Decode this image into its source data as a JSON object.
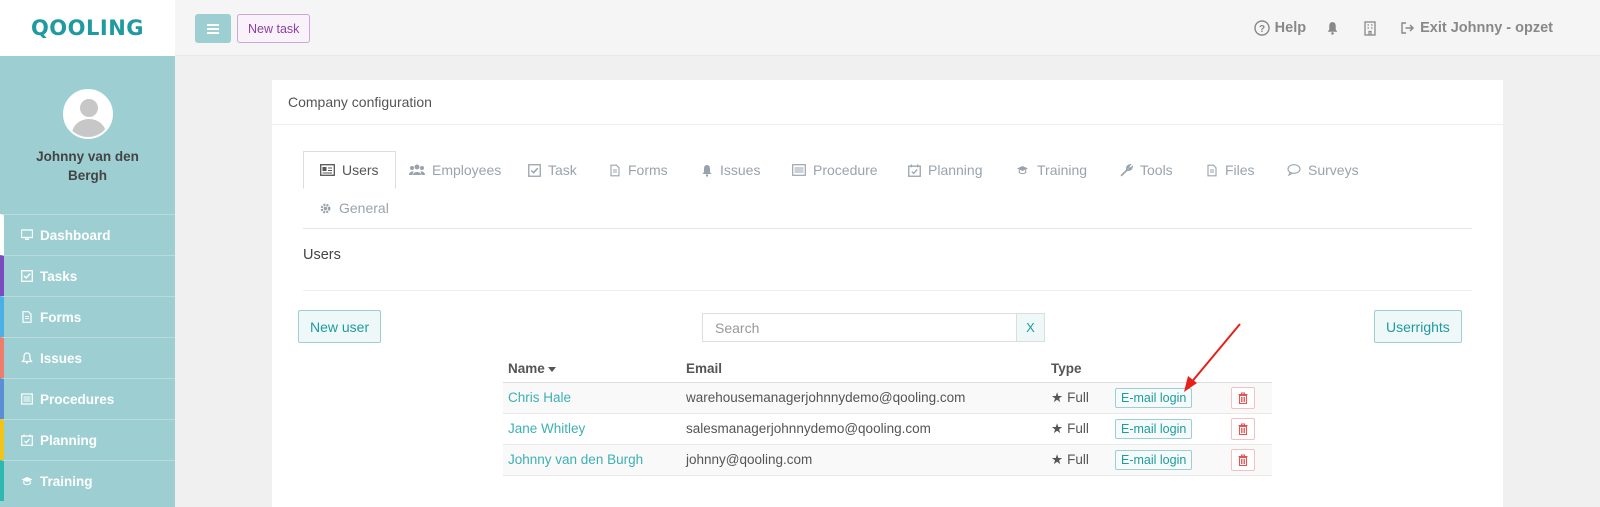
{
  "app": {
    "logo": "Qooling"
  },
  "user": {
    "name": "Johnny van den Bergh"
  },
  "sidebar": {
    "items": [
      {
        "label": "Dashboard",
        "icon": "monitor-icon",
        "accent": "#ffffff"
      },
      {
        "label": "Tasks",
        "icon": "check-square-icon",
        "accent": "#7b4bbf"
      },
      {
        "label": "Forms",
        "icon": "file-icon",
        "accent": "#4ab0e8"
      },
      {
        "label": "Issues",
        "icon": "bell-icon",
        "accent": "#f07c6c"
      },
      {
        "label": "Procedures",
        "icon": "list-icon",
        "accent": "#5a8fd6"
      },
      {
        "label": "Planning",
        "icon": "calendar-check-icon",
        "accent": "#f0c419"
      },
      {
        "label": "Training",
        "icon": "graduation-cap-icon",
        "accent": "#2fb8b0"
      }
    ]
  },
  "topbar": {
    "new_task": "New task",
    "help": "Help",
    "exit": "Exit Johnny - opzet"
  },
  "panel": {
    "title": "Company configuration",
    "tabs": [
      {
        "label": "Users",
        "icon": "id-card-icon",
        "active": true
      },
      {
        "label": "Employees",
        "icon": "users-icon"
      },
      {
        "label": "Task",
        "icon": "check-square-icon"
      },
      {
        "label": "Forms",
        "icon": "file-icon"
      },
      {
        "label": "Issues",
        "icon": "bell-icon"
      },
      {
        "label": "Procedure",
        "icon": "list-icon"
      },
      {
        "label": "Planning",
        "icon": "calendar-check-icon"
      },
      {
        "label": "Training",
        "icon": "graduation-cap-icon"
      },
      {
        "label": "Tools",
        "icon": "wrench-icon"
      },
      {
        "label": "Files",
        "icon": "file-icon"
      },
      {
        "label": "Surveys",
        "icon": "chat-bubble-icon"
      },
      {
        "label": "General",
        "icon": "gear-icon"
      }
    ],
    "section_title": "Users",
    "new_user": "New user",
    "search_placeholder": "Search",
    "search_clear": "X",
    "userrights": "Userrights",
    "table": {
      "columns": [
        "Name",
        "Email",
        "Type"
      ],
      "rows": [
        {
          "name": "Chris Hale",
          "email": "warehousemanagerjohnnydemo@qooling.com",
          "type": "Full",
          "action": "E-mail login"
        },
        {
          "name": "Jane Whitley",
          "email": "salesmanagerjohnnydemo@qooling.com",
          "type": "Full",
          "action": "E-mail login"
        },
        {
          "name": "Johnny van den Burgh",
          "email": "johnny@qooling.com",
          "type": "Full",
          "action": "E-mail login"
        }
      ]
    }
  },
  "colors": {
    "accent": "#1f9aa0",
    "sidebar": "#9dcfd2",
    "danger": "#e05555",
    "annotation": "#e8201a"
  }
}
